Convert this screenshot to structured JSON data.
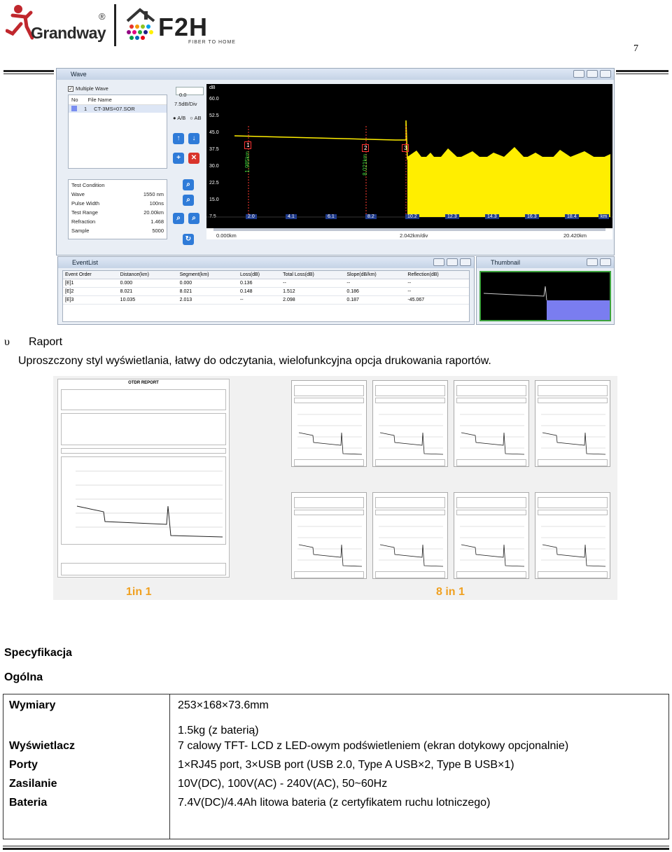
{
  "header": {
    "brand_logo": "Grandway",
    "brand_reg": "®",
    "partner_logo": "F2H",
    "partner_tagline": "FIBER TO HOME",
    "page_number": "7"
  },
  "wave_window": {
    "title": "Wave",
    "multiple_wave_label": "Multiple Wave",
    "list_headers": [
      "No",
      "File Name"
    ],
    "list_rows": [
      {
        "no": "1",
        "file": "CT-3MS=07.SOR"
      }
    ],
    "offset_value": "0.0",
    "scale_label": "7.5dB/Div",
    "mode_a": "A/B",
    "mode_b": "AB",
    "test_condition_title": "Test Condition",
    "test_condition": [
      {
        "label": "Wave",
        "value": "1550 nm"
      },
      {
        "label": "Pulse Width",
        "value": "100ns"
      },
      {
        "label": "Test Range",
        "value": "20.00km"
      },
      {
        "label": "Refraction",
        "value": "1.468"
      },
      {
        "label": "Sample",
        "value": "5000"
      }
    ],
    "y_unit": "dB",
    "y_ticks": [
      "60.0",
      "52.5",
      "45.0",
      "37.5",
      "30.0",
      "22.5",
      "15.0",
      "7.5"
    ],
    "x_ticks": [
      "2.0",
      "4.1",
      "6.1",
      "8.2",
      "10.2",
      "12.3",
      "14.3",
      "16.3",
      "18.4"
    ],
    "x_unit": "km",
    "range_start": "0.000km",
    "range_div": "2.042km/div",
    "range_end": "20.420km",
    "events": [
      {
        "n": "1",
        "dist": "1.985km"
      },
      {
        "n": "2",
        "dist": "8.021km"
      },
      {
        "n": "3",
        "dist": "10.035km"
      }
    ]
  },
  "event_list": {
    "title": "EventList",
    "headers": [
      "Event Order",
      "Distance(km)",
      "Segment(km)",
      "Loss(dB)",
      "Total Loss(dB)",
      "Slope(dB/km)",
      "Reflection(dB)"
    ],
    "rows": [
      [
        "[E]1",
        "0.000",
        "0.000",
        "0.136",
        "--",
        "--",
        "--"
      ],
      [
        "[E]2",
        "8.021",
        "8.021",
        "0.148",
        "1.512",
        "0.186",
        "--"
      ],
      [
        "[E]3",
        "10.035",
        "2.013",
        "--",
        "2.098",
        "0.187",
        "-45.067"
      ]
    ]
  },
  "thumbnail": {
    "title": "Thumbnail"
  },
  "report_section": {
    "bullet": "υ",
    "title": "Raport",
    "description": "Uproszczony styl wyświetlania, łatwy do odczytania, wielofunkcyjna opcja drukowania raportów.",
    "one_title": "OTDR REPORT",
    "label_1in1": "1in 1",
    "label_8in1": "8 in 1"
  },
  "spec": {
    "heading": "Specyfikacja",
    "subheading": "Ogólna",
    "rows": [
      {
        "key": "Wymiary",
        "value": "253×168×73.6mm"
      },
      {
        "key": "",
        "value": "1.5kg (z baterią)"
      },
      {
        "key": "Wyświetlacz",
        "value": "7 calowy TFT- LCD z LED-owym podświetleniem (ekran dotykowy opcjonalnie)"
      },
      {
        "key": "Porty",
        "value": "1×RJ45 port, 3×USB port (USB 2.0, Type A USB×2, Type B USB×1)"
      },
      {
        "key": "Zasilanie",
        "value": "10V(DC), 100V(AC) - 240V(AC), 50~60Hz"
      },
      {
        "key": "Bateria",
        "value": "7.4V(DC)/4.4Ah litowa bateria (z certyfikatem ruchu lotniczego)"
      }
    ]
  },
  "colors": {
    "trace": "#ffee00",
    "accent_orange": "#f0a020",
    "graph_bg": "#000000"
  }
}
